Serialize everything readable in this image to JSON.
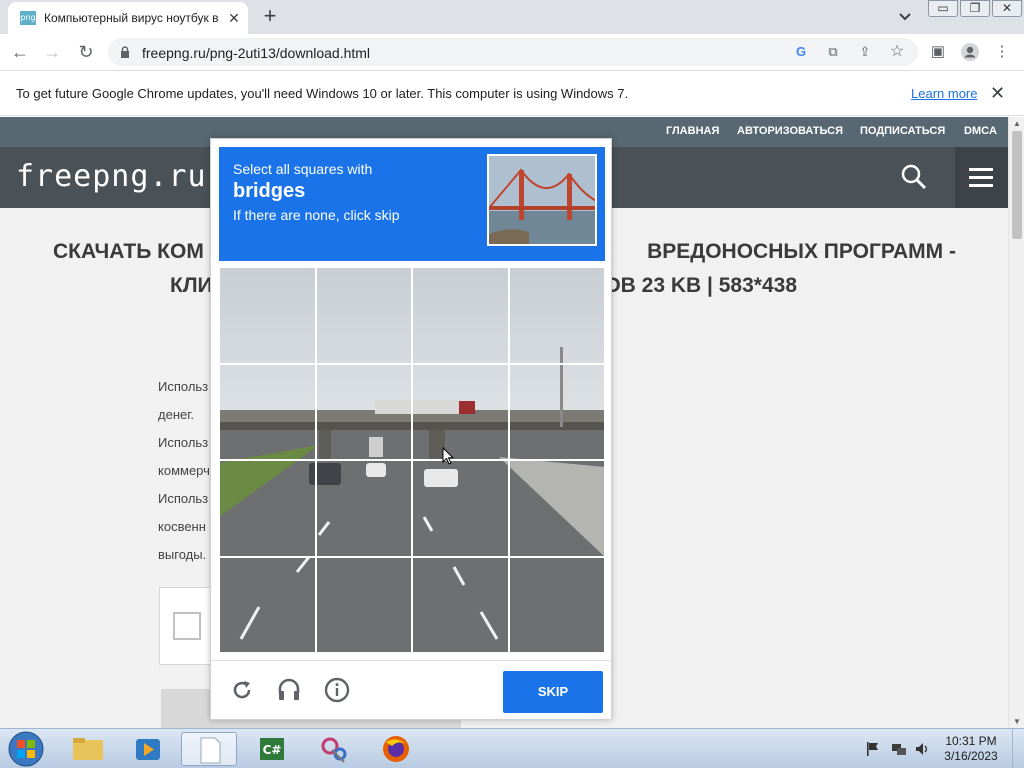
{
  "browser": {
    "tab": {
      "title": "Компьютерный вирус ноутбук в",
      "favicon_text": "png"
    },
    "url": "freepng.ru/png-2uti13/download.html",
    "window_controls": [
      "▭",
      "❐",
      "✕"
    ]
  },
  "infobar": {
    "message": "To get future Google Chrome updates, you'll need Windows 10 or later. This computer is using Windows 7.",
    "link": "Learn more"
  },
  "site": {
    "topnav": [
      "ГЛАВНАЯ",
      "АВТОРИЗОВАТЬСЯ",
      "ПОДПИСАТЬСЯ",
      "DMCA"
    ],
    "logo": "freepng.ru",
    "title_line1_left": "СКАЧАТЬ КОМ",
    "title_line1_right": "ВРЕДОНОСНЫХ ПРОГРАММ -",
    "title_line2_left": "КЛИ",
    "title_line2_right": "СОВ 23 KB | 583*438",
    "body_lines": [
      "Использ",
      "денег.",
      "Использ",
      "коммерч",
      "Использ",
      "косвенн",
      "выгоды."
    ]
  },
  "captcha": {
    "instruction_top": "Select all squares with",
    "keyword": "bridges",
    "instruction_bottom": "If there are none, click skip",
    "skip_label": "SKIP",
    "grid_rows": 4,
    "grid_cols": 4
  },
  "taskbar": {
    "time": "10:31 PM",
    "date": "3/16/2023"
  }
}
